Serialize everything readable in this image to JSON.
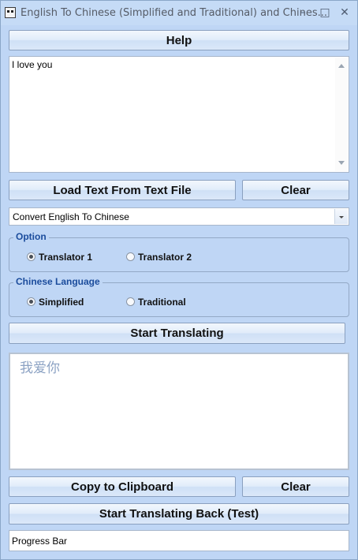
{
  "window": {
    "title": "English To Chinese (Simplified and Traditional) and Chines...",
    "minimize_glyph": "–",
    "maximize_glyph": "□",
    "close_glyph": "✕"
  },
  "buttons": {
    "help": "Help",
    "load_text": "Load Text From Text File",
    "clear_top": "Clear",
    "start_translating": "Start Translating",
    "copy_clipboard": "Copy to Clipboard",
    "clear_bottom": "Clear",
    "translate_back": "Start Translating Back (Test)"
  },
  "input": {
    "value": "I love you"
  },
  "direction": {
    "selected": "Convert English To Chinese"
  },
  "option_group": {
    "legend": "Option",
    "items": [
      {
        "label": "Translator 1",
        "checked": true
      },
      {
        "label": "Translator 2",
        "checked": false
      }
    ]
  },
  "language_group": {
    "legend": "Chinese Language",
    "items": [
      {
        "label": "Simplified",
        "checked": true
      },
      {
        "label": "Traditional",
        "checked": false
      }
    ]
  },
  "output": {
    "value": "我爱你"
  },
  "progress": {
    "label": "Progress Bar"
  },
  "icons": {
    "app": "panda-app-icon",
    "minimize": "minimize-icon",
    "maximize": "maximize-icon",
    "close": "close-icon",
    "scroll_up": "scroll-up-arrow-icon",
    "scroll_down": "scroll-down-arrow-icon",
    "dropdown": "chevron-down-icon"
  },
  "colors": {
    "window_bg": "#bfd6f5",
    "legend_text": "#1b4c9c",
    "output_text": "#8da3c4"
  }
}
